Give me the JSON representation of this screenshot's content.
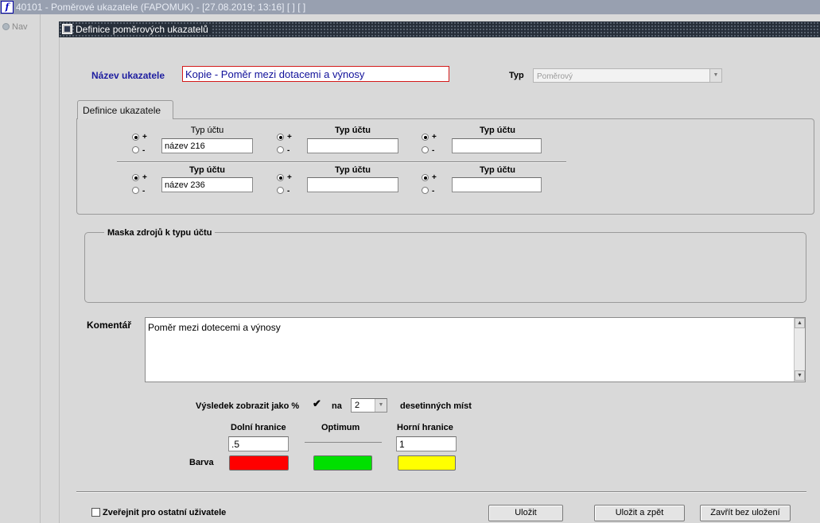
{
  "window": {
    "title": "40101 - Poměrové ukazatele (FAPOMUK) - [27.08.2019; 13:16]  [ ]  [ ]",
    "app_icon": "oracle-forms-icon"
  },
  "nav": {
    "label": "Nav"
  },
  "form": {
    "title": "Definice poměrových ukazatelů",
    "name_label": "Název ukazatele",
    "name_value": "Kopie - Poměr mezi dotacemi a výnosy",
    "type_label": "Typ",
    "type_value": "Poměrový",
    "tab_label": "Definice ukazatele",
    "rows": [
      [
        {
          "header": "Typ účtu",
          "header_bold": false,
          "value": "název 216",
          "sign": "+"
        },
        {
          "header": "Typ účtu",
          "header_bold": true,
          "value": "",
          "sign": "+"
        },
        {
          "header": "Typ účtu",
          "header_bold": true,
          "value": "",
          "sign": "+"
        }
      ],
      [
        {
          "header": "Typ účtu",
          "header_bold": true,
          "value": "název 236",
          "sign": "+"
        },
        {
          "header": "Typ účtu",
          "header_bold": true,
          "value": "",
          "sign": "+"
        },
        {
          "header": "Typ účtu",
          "header_bold": true,
          "value": "",
          "sign": "+"
        }
      ]
    ],
    "plus_sign": "+",
    "minus_sign": "-",
    "mask_title": "Maska zdrojů k typu účtu",
    "comment_label": "Komentář",
    "comment_value": "Poměr mezi dotecemi a výnosy",
    "result_label": "Výsledek zobrazit jako %",
    "result_percent_checked": true,
    "na_label": "na",
    "decimals_value": "2",
    "decimals_suffix": "desetinných míst",
    "lower_label": "Dolní hranice",
    "optimum_label": "Optimum",
    "upper_label": "Horní hranice",
    "lower_value": ".5",
    "upper_value": "1",
    "color_label": "Barva",
    "colors": {
      "lower": "#ff0000",
      "optimum": "#00e000",
      "upper": "#ffff00"
    },
    "publish_label": "Zveřejnit pro ostatní uživatele",
    "publish_checked": false
  },
  "buttons": {
    "save": "Uložit",
    "save_back": "Uložit a zpět",
    "close_no_save": "Zavřít bez uložení"
  }
}
